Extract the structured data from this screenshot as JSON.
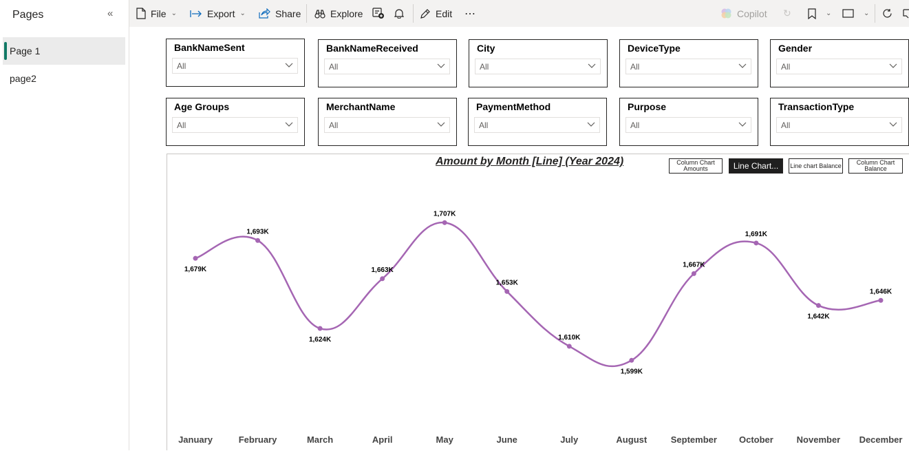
{
  "pages_pane": {
    "title": "Pages",
    "items": [
      {
        "label": "Page 1",
        "active": true
      },
      {
        "label": "page2",
        "active": false
      }
    ]
  },
  "toolbar": {
    "file": "File",
    "export": "Export",
    "share": "Share",
    "explore": "Explore",
    "edit": "Edit",
    "more": "⋯",
    "copilot": "Copilot"
  },
  "slicers": [
    {
      "title": "BankNameSent",
      "value": "All"
    },
    {
      "title": "BankNameReceived",
      "value": "All"
    },
    {
      "title": "City",
      "value": "All"
    },
    {
      "title": "DeviceType",
      "value": "All"
    },
    {
      "title": "Gender",
      "value": "All"
    },
    {
      "title": "Age Groups",
      "value": "All"
    },
    {
      "title": "MerchantName",
      "value": "All"
    },
    {
      "title": "PaymentMethod",
      "value": "All"
    },
    {
      "title": "Purpose",
      "value": "All"
    },
    {
      "title": "TransactionType",
      "value": "All"
    }
  ],
  "chart_buttons": {
    "column_amounts_line1": "Column Chart",
    "column_amounts_line2": "Amounts",
    "line_chart": "Line Chart...",
    "line_balance": "Line chart Balance",
    "column_balance_line1": "Column Chart",
    "column_balance_line2": "Balance"
  },
  "colors": {
    "line": "#A566B3",
    "accent": "#117865"
  },
  "chart_data": {
    "type": "line",
    "title": "Amount by Month [Line] (Year 2024)",
    "categories": [
      "January",
      "February",
      "March",
      "April",
      "May",
      "June",
      "July",
      "August",
      "September",
      "October",
      "November",
      "December"
    ],
    "values": [
      1679,
      1693,
      1624,
      1663,
      1707,
      1653,
      1610,
      1599,
      1667,
      1691,
      1642,
      1646
    ],
    "value_labels": [
      "1,679K",
      "1,693K",
      "1,624K",
      "1,663K",
      "1,707K",
      "1,653K",
      "1,610K",
      "1,599K",
      "1,667K",
      "1,691K",
      "1,642K",
      "1,646K"
    ],
    "label_position": [
      "below",
      "above",
      "below",
      "above",
      "above",
      "above",
      "above",
      "below",
      "above",
      "above",
      "below",
      "above"
    ],
    "ylim": [
      1570,
      1725
    ],
    "xlabel": "",
    "ylabel": "",
    "grid": false,
    "smooth": true
  }
}
